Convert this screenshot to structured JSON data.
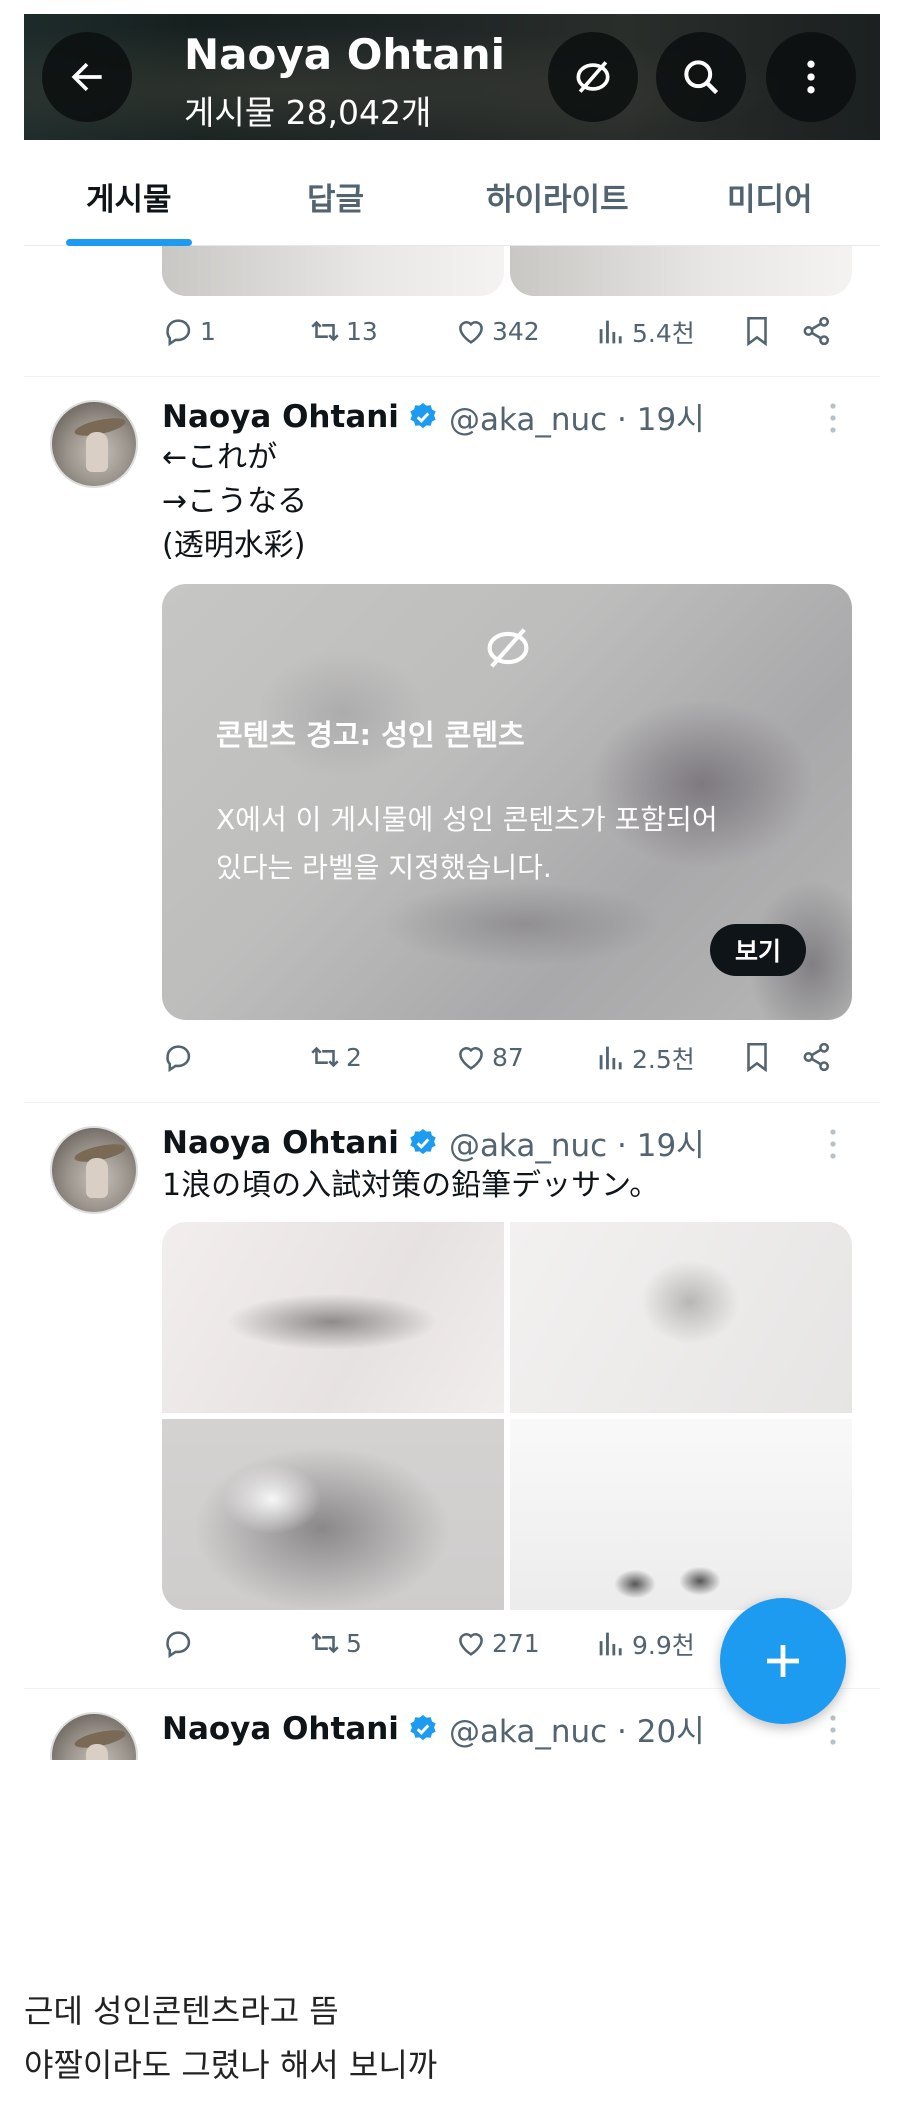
{
  "header": {
    "title": "Naoya Ohtani",
    "subtitle": "게시물 28,042개"
  },
  "tabs": [
    {
      "label": "게시물",
      "active": true
    },
    {
      "label": "답글",
      "active": false
    },
    {
      "label": "하이라이트",
      "active": false
    },
    {
      "label": "미디어",
      "active": false
    }
  ],
  "posts": [
    {
      "replies": "1",
      "reposts": "13",
      "likes": "342",
      "views": "5.4천"
    },
    {
      "author": "Naoya Ohtani",
      "handle": "@aka_nuc · 19시",
      "text": "←これが\n→こうなる\n(透明水彩)",
      "warning": {
        "title": "콘텐츠 경고: 성인 콘텐츠",
        "body": "X에서 이 게시물에 성인 콘텐츠가 포함되어\n있다는 라벨을 지정했습니다.",
        "view_label": "보기"
      },
      "replies": "",
      "reposts": "2",
      "likes": "87",
      "views": "2.5천"
    },
    {
      "author": "Naoya Ohtani",
      "handle": "@aka_nuc · 19시",
      "text": "1浪の頃の入試対策の鉛筆デッサン。",
      "replies": "",
      "reposts": "5",
      "likes": "271",
      "views": "9.9천"
    },
    {
      "author": "Naoya Ohtani",
      "handle": "@aka_nuc · 20시"
    }
  ],
  "caption": [
    "근데 성인콘텐츠라고 뜸",
    "야짤이라도 그렸나 해서 보니까"
  ],
  "colors": {
    "accent": "#1d9bf0",
    "verified": "#1d9bf0",
    "muted": "#536471"
  }
}
